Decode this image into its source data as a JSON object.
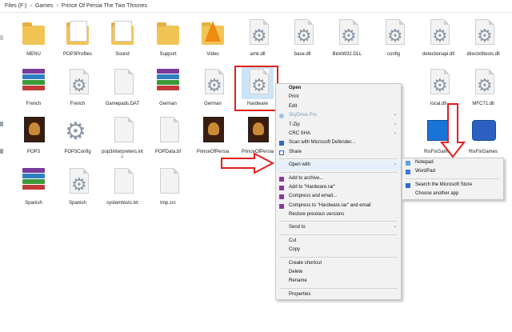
{
  "breadcrumb": [
    "Files (F:)",
    "Games",
    "Prince Of Persia The Two Thrones"
  ],
  "colors": {
    "accent_red": "#e02020",
    "highlight": "#e5f0fb",
    "folder": "#f1c455"
  },
  "files": [
    {
      "label": "MENU",
      "icon": "folder-icon"
    },
    {
      "label": "POP3Profiles",
      "icon": "folder-doc-icon"
    },
    {
      "label": "Sound",
      "icon": "folder-doc-icon"
    },
    {
      "label": "Support",
      "icon": "folder-icon"
    },
    {
      "label": "Video",
      "icon": "vlc-folder-icon"
    },
    {
      "label": "amir.dll",
      "icon": "gear-doc-icon"
    },
    {
      "label": "base.dll",
      "icon": "gear-doc-icon"
    },
    {
      "label": "BinkW32.DLL",
      "icon": "gear-doc-icon"
    },
    {
      "label": "config",
      "icon": "gear-doc-icon"
    },
    {
      "label": "detectionapi.dll",
      "icon": "gear-doc-icon"
    },
    {
      "label": "directx9tests.dll",
      "icon": "gear-doc-icon"
    },
    {
      "label": "French",
      "icon": "rar-icon"
    },
    {
      "label": "French",
      "icon": "gear-doc-icon"
    },
    {
      "label": "Gamepads.DAT",
      "icon": "doc-icon"
    },
    {
      "label": "German",
      "icon": "rar-icon"
    },
    {
      "label": "German",
      "icon": "gear-doc-icon"
    },
    {
      "label": "Hardware",
      "icon": "gear-doc-icon"
    },
    {
      "label": "local.dll",
      "icon": "gear-doc-icon"
    },
    {
      "label": "MFC71.dll",
      "icon": "gear-doc-icon"
    },
    {
      "label": "POP3",
      "icon": "game-icon"
    },
    {
      "label": "POP3Config",
      "icon": "gear-icon"
    },
    {
      "label": "pop3interpreters.intr",
      "icon": "doc-icon"
    },
    {
      "label": "POPData.bf",
      "icon": "doc-icon"
    },
    {
      "label": "PrinceOfPersia",
      "icon": "game-icon"
    },
    {
      "label": "PrinceOfPersia",
      "icon": "game-icon"
    },
    {
      "label": "RisFixGames",
      "icon": "app-icon"
    },
    {
      "label": "RisFixGames",
      "icon": "app-icon"
    },
    {
      "label": "Spanish",
      "icon": "rar-icon"
    },
    {
      "label": "Spanish",
      "icon": "gear-doc-icon"
    },
    {
      "label": "systemtests.txt",
      "icon": "doc-icon"
    },
    {
      "label": "tmp.crc",
      "icon": "doc-icon"
    }
  ],
  "context_menu": {
    "items": [
      "Open",
      "Print",
      "Edit",
      "SkyDrive Pro",
      "7-Zip",
      "CRC SHA",
      "Scan with Microsoft Defender...",
      "Share",
      "Open with",
      "Add to archive...",
      "Add to \"Hardware.rar\"",
      "Compress and email...",
      "Compress to \"Hardware.rar\" and email",
      "Restore previous versions",
      "Send to",
      "Cut",
      "Copy",
      "Create shortcut",
      "Delete",
      "Rename",
      "Properties"
    ]
  },
  "submenu": {
    "items": [
      "Notepad",
      "WordPad",
      "Search the Microsoft Store",
      "Choose another app"
    ]
  }
}
